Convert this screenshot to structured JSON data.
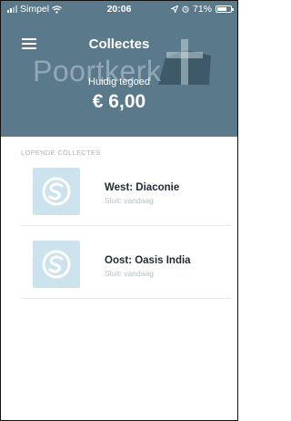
{
  "status_bar": {
    "carrier": "Simpel",
    "time": "20:06",
    "battery": "71%",
    "battery_level": 0.71
  },
  "header": {
    "title": "Collectes",
    "logo_text": "Poortkerk",
    "credit_label": "Huidig tegoed",
    "credit_amount": "€ 6,00",
    "background_color": "#5a7a8c"
  },
  "section": {
    "title": "LOPENDE COLLECTES"
  },
  "collections": [
    {
      "name": "West: Diaconie",
      "closes": "Sluit: vandaag"
    },
    {
      "name": "Oost: Oasis India",
      "closes": "Sluit: vandaag"
    }
  ],
  "icons": {
    "menu": "hamburger-icon",
    "collection": "s-logo-icon",
    "location": "location-arrow-icon",
    "alarm": "alarm-icon"
  }
}
